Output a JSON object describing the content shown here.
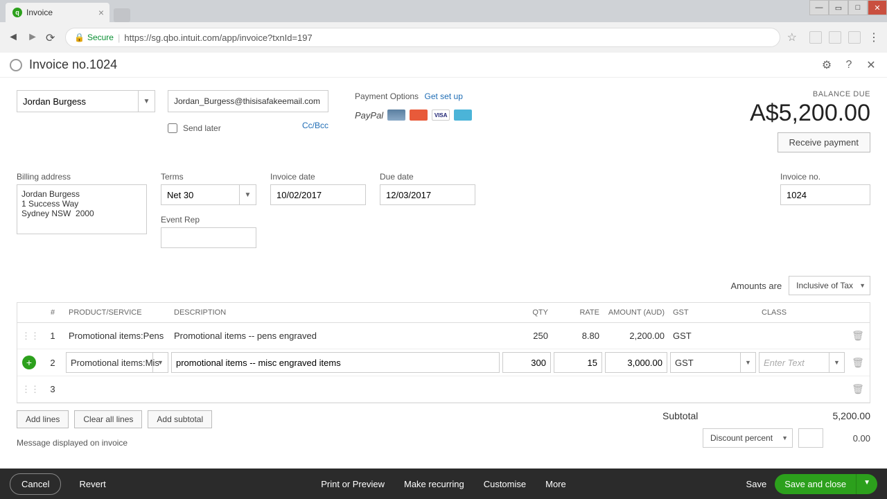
{
  "browser": {
    "tab_title": "Invoice",
    "url": "https://sg.qbo.intuit.com/app/invoice?txnId=197",
    "secure_label": "Secure"
  },
  "header": {
    "title": "Invoice no.1024"
  },
  "customer": {
    "name": "Jordan Burgess",
    "email": "Jordan_Burgess@thisisafakeemail.com",
    "send_later_label": "Send later",
    "ccbcc": "Cc/Bcc"
  },
  "payment": {
    "label": "Payment Options",
    "link": "Get set up",
    "paypal": "PayPal",
    "visa": "VISA"
  },
  "balance": {
    "label": "BALANCE DUE",
    "amount": "A$5,200.00",
    "receive_btn": "Receive payment"
  },
  "meta": {
    "billing_label": "Billing address",
    "billing_value": "Jordan Burgess\n1 Success Way\nSydney NSW  2000",
    "terms_label": "Terms",
    "terms_value": "Net 30",
    "invoice_date_label": "Invoice date",
    "invoice_date_value": "10/02/2017",
    "due_date_label": "Due date",
    "due_date_value": "12/03/2017",
    "event_rep_label": "Event Rep",
    "event_rep_value": "",
    "invoice_no_label": "Invoice no.",
    "invoice_no_value": "1024"
  },
  "amounts_are": {
    "label": "Amounts are",
    "value": "Inclusive of Tax"
  },
  "table": {
    "headers": {
      "num": "#",
      "product": "PRODUCT/SERVICE",
      "description": "DESCRIPTION",
      "qty": "QTY",
      "rate": "RATE",
      "amount": "AMOUNT (AUD)",
      "gst": "GST",
      "class": "CLASS"
    },
    "rows": [
      {
        "num": "1",
        "product": "Promotional items:Pens",
        "description": "Promotional items -- pens engraved",
        "qty": "250",
        "rate": "8.80",
        "amount": "2,200.00",
        "gst": "GST",
        "class": ""
      },
      {
        "num": "2",
        "product": "Promotional items:Mis",
        "description": "promotional items -- misc engraved items",
        "qty": "300",
        "rate": "15",
        "amount": "3,000.00",
        "gst": "GST",
        "class_placeholder": "Enter Text"
      },
      {
        "num": "3",
        "product": "",
        "description": "",
        "qty": "",
        "rate": "",
        "amount": "",
        "gst": "",
        "class": ""
      }
    ]
  },
  "line_buttons": {
    "add_lines": "Add lines",
    "clear_all": "Clear all lines",
    "add_subtotal": "Add subtotal"
  },
  "totals": {
    "subtotal_label": "Subtotal",
    "subtotal_value": "5,200.00",
    "discount_label": "Discount percent",
    "discount_value": "0.00"
  },
  "message_label": "Message displayed on invoice",
  "footer": {
    "cancel": "Cancel",
    "revert": "Revert",
    "print": "Print or Preview",
    "recurring": "Make recurring",
    "customise": "Customise",
    "more": "More",
    "save": "Save",
    "save_close": "Save and close"
  }
}
